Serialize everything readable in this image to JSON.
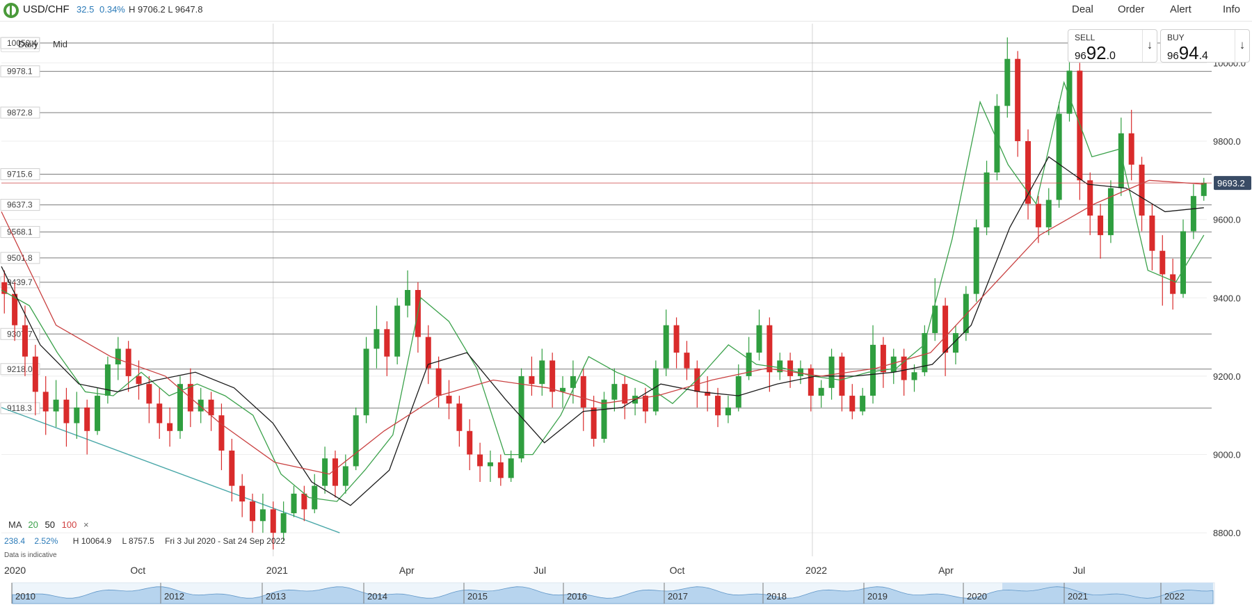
{
  "header": {
    "symbol": "USD/CHF",
    "change": "32.5",
    "change_pct": "0.34%",
    "high_low": "H 9706.2  L 9647.8",
    "menu": [
      "Deal",
      "Order",
      "Alert",
      "Info"
    ]
  },
  "sell": {
    "label": "SELL",
    "p1": "96",
    "p2": "92",
    "p3": ".0"
  },
  "buy": {
    "label": "BUY",
    "p1": "96",
    "p2": "94",
    "p3": ".4"
  },
  "toolbar": {
    "timeframe": "Daily",
    "price_type": "Mid"
  },
  "ma_legend": {
    "label": "MA",
    "ma20": "20",
    "ma50": "50",
    "ma100": "100",
    "close": "×"
  },
  "stats": {
    "change": "238.4",
    "pct": "2.52%",
    "high": "H 10064.9",
    "low": "L 8757.5",
    "range": "Fri 3 Jul 2020 - Sat 24 Sep 2022"
  },
  "disclaimer": "Data is indicative",
  "colors": {
    "up": "#2f9e3f",
    "down": "#d92b2b",
    "ma20": "#3aa14a",
    "ma50": "#1a1a1a",
    "ma100": "#c94040",
    "trend": "#49a7a8",
    "accent": "#2a7ab8",
    "current_tag": "#394b65"
  },
  "chart_data": {
    "type": "candlestick",
    "series": [
      {
        "name": "MA 20",
        "values": [
          9420,
          9380,
          9260,
          9160,
          9150,
          9210,
          9150,
          9180,
          9150,
          9100,
          8950,
          8890,
          8880,
          8960,
          9050,
          9400,
          9340,
          9220,
          9000,
          9000,
          9100,
          9250,
          9210,
          9180,
          9130,
          9200,
          9280,
          9230,
          9220,
          9200,
          9190,
          9210,
          9220,
          9280,
          9550,
          9900,
          9740,
          9640,
          9950,
          9760,
          9780,
          9470,
          9440,
          9560
        ]
      },
      {
        "name": "MA 50",
        "values": [
          9480,
          9280,
          9180,
          9160,
          9190,
          9210,
          9170,
          9080,
          8930,
          8870,
          8960,
          9230,
          9260,
          9140,
          9030,
          9110,
          9120,
          9180,
          9160,
          9150,
          9180,
          9200,
          9200,
          9210,
          9230,
          9330,
          9580,
          9760,
          9690,
          9680,
          9620,
          9630
        ]
      },
      {
        "name": "MA 100",
        "values": [
          9620,
          9330,
          9250,
          9200,
          9080,
          8980,
          8950,
          9060,
          9150,
          9190,
          9170,
          9130,
          9150,
          9190,
          9220,
          9200,
          9220,
          9260,
          9410,
          9560,
          9640,
          9700,
          9690
        ]
      },
      {
        "name": "Trendline",
        "values": [
          9120,
          8800
        ]
      }
    ],
    "candles": [
      {
        "d": "2020-07-03",
        "o": 9440,
        "h": 9470,
        "c": 9410,
        "l": 9360
      },
      {
        "d": "2020-07-10",
        "o": 9410,
        "h": 9440,
        "c": 9330,
        "l": 9290
      },
      {
        "d": "2020-07-17",
        "o": 9330,
        "h": 9380,
        "c": 9250,
        "l": 9200
      },
      {
        "d": "2020-07-24",
        "o": 9250,
        "h": 9280,
        "c": 9160,
        "l": 9100
      },
      {
        "d": "2020-07-31",
        "o": 9160,
        "h": 9200,
        "c": 9110,
        "l": 9050
      },
      {
        "d": "2020-08-07",
        "o": 9110,
        "h": 9190,
        "c": 9140,
        "l": 9070
      },
      {
        "d": "2020-08-14",
        "o": 9140,
        "h": 9170,
        "c": 9080,
        "l": 9020
      },
      {
        "d": "2020-08-21",
        "o": 9080,
        "h": 9160,
        "c": 9120,
        "l": 9040
      },
      {
        "d": "2020-08-28",
        "o": 9120,
        "h": 9140,
        "c": 9060,
        "l": 9000
      },
      {
        "d": "2020-09-04",
        "o": 9060,
        "h": 9170,
        "c": 9150,
        "l": 9050
      },
      {
        "d": "2020-09-11",
        "o": 9150,
        "h": 9250,
        "c": 9230,
        "l": 9130
      },
      {
        "d": "2020-09-18",
        "o": 9230,
        "h": 9300,
        "c": 9270,
        "l": 9190
      },
      {
        "d": "2020-09-25",
        "o": 9270,
        "h": 9290,
        "c": 9200,
        "l": 9160
      },
      {
        "d": "2020-10-02",
        "o": 9200,
        "h": 9240,
        "c": 9180,
        "l": 9140
      },
      {
        "d": "2020-10-09",
        "o": 9180,
        "h": 9200,
        "c": 9130,
        "l": 9080
      },
      {
        "d": "2020-10-16",
        "o": 9130,
        "h": 9170,
        "c": 9080,
        "l": 9040
      },
      {
        "d": "2020-10-23",
        "o": 9080,
        "h": 9120,
        "c": 9060,
        "l": 9020
      },
      {
        "d": "2020-10-30",
        "o": 9060,
        "h": 9200,
        "c": 9180,
        "l": 9040
      },
      {
        "d": "2020-11-06",
        "o": 9180,
        "h": 9220,
        "c": 9110,
        "l": 9070
      },
      {
        "d": "2020-11-13",
        "o": 9110,
        "h": 9170,
        "c": 9140,
        "l": 9080
      },
      {
        "d": "2020-11-20",
        "o": 9140,
        "h": 9160,
        "c": 9100,
        "l": 9060
      },
      {
        "d": "2020-11-27",
        "o": 9100,
        "h": 9130,
        "c": 9010,
        "l": 8960
      },
      {
        "d": "2020-12-04",
        "o": 9010,
        "h": 9040,
        "c": 8920,
        "l": 8880
      },
      {
        "d": "2020-12-11",
        "o": 8920,
        "h": 8950,
        "c": 8880,
        "l": 8840
      },
      {
        "d": "2020-12-18",
        "o": 8880,
        "h": 8900,
        "c": 8830,
        "l": 8800
      },
      {
        "d": "2020-12-25",
        "o": 8830,
        "h": 8900,
        "c": 8860,
        "l": 8800
      },
      {
        "d": "2021-01-01",
        "o": 8860,
        "h": 8880,
        "c": 8800,
        "l": 8757.5
      },
      {
        "d": "2021-01-08",
        "o": 8800,
        "h": 8880,
        "c": 8850,
        "l": 8780
      },
      {
        "d": "2021-01-15",
        "o": 8850,
        "h": 8920,
        "c": 8900,
        "l": 8840
      },
      {
        "d": "2021-01-22",
        "o": 8900,
        "h": 8920,
        "c": 8860,
        "l": 8830
      },
      {
        "d": "2021-01-29",
        "o": 8860,
        "h": 8950,
        "c": 8920,
        "l": 8850
      },
      {
        "d": "2021-02-05",
        "o": 8920,
        "h": 9020,
        "c": 8990,
        "l": 8900
      },
      {
        "d": "2021-02-12",
        "o": 8990,
        "h": 9010,
        "c": 8920,
        "l": 8890
      },
      {
        "d": "2021-02-19",
        "o": 8920,
        "h": 9000,
        "c": 8970,
        "l": 8900
      },
      {
        "d": "2021-02-26",
        "o": 8970,
        "h": 9120,
        "c": 9100,
        "l": 8960
      },
      {
        "d": "2021-03-05",
        "o": 9100,
        "h": 9300,
        "c": 9270,
        "l": 9080
      },
      {
        "d": "2021-03-12",
        "o": 9270,
        "h": 9380,
        "c": 9320,
        "l": 9220
      },
      {
        "d": "2021-03-19",
        "o": 9320,
        "h": 9340,
        "c": 9250,
        "l": 9200
      },
      {
        "d": "2021-03-26",
        "o": 9250,
        "h": 9400,
        "c": 9380,
        "l": 9230
      },
      {
        "d": "2021-04-02",
        "o": 9380,
        "h": 9470,
        "c": 9420,
        "l": 9350
      },
      {
        "d": "2021-04-09",
        "o": 9420,
        "h": 9440,
        "c": 9300,
        "l": 9260
      },
      {
        "d": "2021-04-16",
        "o": 9300,
        "h": 9330,
        "c": 9220,
        "l": 9180
      },
      {
        "d": "2021-04-23",
        "o": 9220,
        "h": 9250,
        "c": 9150,
        "l": 9120
      },
      {
        "d": "2021-04-30",
        "o": 9150,
        "h": 9190,
        "c": 9130,
        "l": 9090
      },
      {
        "d": "2021-05-07",
        "o": 9130,
        "h": 9150,
        "c": 9060,
        "l": 9020
      },
      {
        "d": "2021-05-14",
        "o": 9060,
        "h": 9090,
        "c": 9000,
        "l": 8960
      },
      {
        "d": "2021-05-21",
        "o": 9000,
        "h": 9030,
        "c": 8970,
        "l": 8930
      },
      {
        "d": "2021-05-28",
        "o": 8970,
        "h": 9010,
        "c": 8980,
        "l": 8930
      },
      {
        "d": "2021-06-04",
        "o": 8980,
        "h": 9000,
        "c": 8940,
        "l": 8920
      },
      {
        "d": "2021-06-11",
        "o": 8940,
        "h": 9010,
        "c": 8990,
        "l": 8930
      },
      {
        "d": "2021-06-18",
        "o": 8990,
        "h": 9220,
        "c": 9200,
        "l": 8980
      },
      {
        "d": "2021-06-25",
        "o": 9200,
        "h": 9250,
        "c": 9180,
        "l": 9150
      },
      {
        "d": "2021-07-02",
        "o": 9180,
        "h": 9270,
        "c": 9240,
        "l": 9150
      },
      {
        "d": "2021-07-09",
        "o": 9240,
        "h": 9260,
        "c": 9160,
        "l": 9120
      },
      {
        "d": "2021-07-16",
        "o": 9160,
        "h": 9200,
        "c": 9170,
        "l": 9120
      },
      {
        "d": "2021-07-23",
        "o": 9170,
        "h": 9240,
        "c": 9200,
        "l": 9130
      },
      {
        "d": "2021-07-30",
        "o": 9200,
        "h": 9220,
        "c": 9120,
        "l": 9060
      },
      {
        "d": "2021-08-06",
        "o": 9120,
        "h": 9150,
        "c": 9040,
        "l": 9020
      },
      {
        "d": "2021-08-13",
        "o": 9040,
        "h": 9160,
        "c": 9140,
        "l": 9030
      },
      {
        "d": "2021-08-20",
        "o": 9140,
        "h": 9220,
        "c": 9180,
        "l": 9110
      },
      {
        "d": "2021-08-27",
        "o": 9180,
        "h": 9200,
        "c": 9130,
        "l": 9090
      },
      {
        "d": "2021-09-03",
        "o": 9130,
        "h": 9170,
        "c": 9150,
        "l": 9100
      },
      {
        "d": "2021-09-10",
        "o": 9150,
        "h": 9170,
        "c": 9110,
        "l": 9080
      },
      {
        "d": "2021-09-17",
        "o": 9110,
        "h": 9240,
        "c": 9220,
        "l": 9100
      },
      {
        "d": "2021-09-24",
        "o": 9220,
        "h": 9370,
        "c": 9330,
        "l": 9200
      },
      {
        "d": "2021-10-01",
        "o": 9330,
        "h": 9350,
        "c": 9260,
        "l": 9220
      },
      {
        "d": "2021-10-08",
        "o": 9260,
        "h": 9290,
        "c": 9220,
        "l": 9190
      },
      {
        "d": "2021-10-15",
        "o": 9220,
        "h": 9240,
        "c": 9160,
        "l": 9120
      },
      {
        "d": "2021-10-22",
        "o": 9160,
        "h": 9200,
        "c": 9150,
        "l": 9110
      },
      {
        "d": "2021-10-29",
        "o": 9150,
        "h": 9170,
        "c": 9100,
        "l": 9070
      },
      {
        "d": "2021-11-05",
        "o": 9100,
        "h": 9150,
        "c": 9120,
        "l": 9080
      },
      {
        "d": "2021-11-12",
        "o": 9120,
        "h": 9230,
        "c": 9200,
        "l": 9110
      },
      {
        "d": "2021-11-19",
        "o": 9200,
        "h": 9300,
        "c": 9260,
        "l": 9190
      },
      {
        "d": "2021-11-26",
        "o": 9260,
        "h": 9370,
        "c": 9330,
        "l": 9240
      },
      {
        "d": "2021-12-03",
        "o": 9330,
        "h": 9350,
        "c": 9210,
        "l": 9160
      },
      {
        "d": "2021-12-10",
        "o": 9210,
        "h": 9260,
        "c": 9240,
        "l": 9190
      },
      {
        "d": "2021-12-17",
        "o": 9240,
        "h": 9260,
        "c": 9200,
        "l": 9170
      },
      {
        "d": "2021-12-24",
        "o": 9200,
        "h": 9240,
        "c": 9220,
        "l": 9180
      },
      {
        "d": "2021-12-31",
        "o": 9220,
        "h": 9230,
        "c": 9150,
        "l": 9110
      },
      {
        "d": "2022-01-07",
        "o": 9150,
        "h": 9190,
        "c": 9170,
        "l": 9120
      },
      {
        "d": "2022-01-14",
        "o": 9170,
        "h": 9270,
        "c": 9250,
        "l": 9140
      },
      {
        "d": "2022-01-21",
        "o": 9250,
        "h": 9260,
        "c": 9150,
        "l": 9110
      },
      {
        "d": "2022-01-28",
        "o": 9150,
        "h": 9180,
        "c": 9110,
        "l": 9090
      },
      {
        "d": "2022-02-04",
        "o": 9110,
        "h": 9170,
        "c": 9150,
        "l": 9100
      },
      {
        "d": "2022-02-11",
        "o": 9150,
        "h": 9330,
        "c": 9280,
        "l": 9130
      },
      {
        "d": "2022-02-18",
        "o": 9280,
        "h": 9300,
        "c": 9210,
        "l": 9170
      },
      {
        "d": "2022-02-25",
        "o": 9210,
        "h": 9270,
        "c": 9250,
        "l": 9180
      },
      {
        "d": "2022-03-04",
        "o": 9250,
        "h": 9270,
        "c": 9190,
        "l": 9150
      },
      {
        "d": "2022-03-11",
        "o": 9190,
        "h": 9230,
        "c": 9210,
        "l": 9160
      },
      {
        "d": "2022-03-18",
        "o": 9210,
        "h": 9330,
        "c": 9310,
        "l": 9200
      },
      {
        "d": "2022-03-25",
        "o": 9310,
        "h": 9450,
        "c": 9380,
        "l": 9290
      },
      {
        "d": "2022-04-01",
        "o": 9380,
        "h": 9400,
        "c": 9260,
        "l": 9200
      },
      {
        "d": "2022-04-08",
        "o": 9260,
        "h": 9330,
        "c": 9310,
        "l": 9230
      },
      {
        "d": "2022-04-15",
        "o": 9310,
        "h": 9430,
        "c": 9410,
        "l": 9290
      },
      {
        "d": "2022-04-22",
        "o": 9410,
        "h": 9600,
        "c": 9580,
        "l": 9390
      },
      {
        "d": "2022-04-29",
        "o": 9580,
        "h": 9750,
        "c": 9720,
        "l": 9560
      },
      {
        "d": "2022-05-06",
        "o": 9720,
        "h": 9920,
        "c": 9890,
        "l": 9700
      },
      {
        "d": "2022-05-13",
        "o": 9890,
        "h": 10064.9,
        "c": 10010,
        "l": 9860
      },
      {
        "d": "2022-05-20",
        "o": 10010,
        "h": 10030,
        "c": 9800,
        "l": 9760
      },
      {
        "d": "2022-05-27",
        "o": 9800,
        "h": 9830,
        "c": 9640,
        "l": 9600
      },
      {
        "d": "2022-06-03",
        "o": 9640,
        "h": 9660,
        "c": 9580,
        "l": 9540
      },
      {
        "d": "2022-06-10",
        "o": 9580,
        "h": 9680,
        "c": 9650,
        "l": 9560
      },
      {
        "d": "2022-06-17",
        "o": 9650,
        "h": 9900,
        "c": 9870,
        "l": 9630
      },
      {
        "d": "2022-06-24",
        "o": 9870,
        "h": 10040,
        "c": 9980,
        "l": 9850
      },
      {
        "d": "2022-07-01",
        "o": 9980,
        "h": 10000,
        "c": 9700,
        "l": 9650
      },
      {
        "d": "2022-07-08",
        "o": 9700,
        "h": 9720,
        "c": 9610,
        "l": 9560
      },
      {
        "d": "2022-07-15",
        "o": 9610,
        "h": 9640,
        "c": 9560,
        "l": 9500
      },
      {
        "d": "2022-07-22",
        "o": 9560,
        "h": 9700,
        "c": 9680,
        "l": 9540
      },
      {
        "d": "2022-07-29",
        "o": 9680,
        "h": 9860,
        "c": 9820,
        "l": 9660
      },
      {
        "d": "2022-08-05",
        "o": 9820,
        "h": 9880,
        "c": 9740,
        "l": 9700
      },
      {
        "d": "2022-08-12",
        "o": 9740,
        "h": 9760,
        "c": 9610,
        "l": 9570
      },
      {
        "d": "2022-08-19",
        "o": 9610,
        "h": 9640,
        "c": 9520,
        "l": 9470
      },
      {
        "d": "2022-08-26",
        "o": 9520,
        "h": 9560,
        "c": 9460,
        "l": 9380
      },
      {
        "d": "2022-09-02",
        "o": 9460,
        "h": 9500,
        "c": 9410,
        "l": 9370
      },
      {
        "d": "2022-09-09",
        "o": 9410,
        "h": 9600,
        "c": 9570,
        "l": 9400
      },
      {
        "d": "2022-09-16",
        "o": 9570,
        "h": 9690,
        "c": 9660,
        "l": 9550
      },
      {
        "d": "2022-09-23",
        "o": 9660,
        "h": 9706.2,
        "c": 9693.2,
        "l": 9647.8
      }
    ],
    "date_range": [
      "2020-07-03",
      "2022-09-24"
    ],
    "x_tick_labels": [
      "2020",
      "Oct",
      "2021",
      "Apr",
      "Jul",
      "Oct",
      "2022",
      "Apr",
      "Jul"
    ],
    "y_ticks": [
      8800,
      9000,
      9200,
      9400,
      9600,
      9800,
      10000
    ],
    "y_tick_labels": [
      "8800.0",
      "9000.0",
      "9200.0",
      "9400.0",
      "9600.0",
      "9800.0",
      "10000.0"
    ],
    "ylim": [
      8740,
      10100
    ],
    "horizontal_levels": [
      10050.4,
      9978.1,
      9872.8,
      9715.6,
      9637.3,
      9568.1,
      9501.8,
      9439.7,
      9307.7,
      9218.0,
      9118.3
    ],
    "level_labels": [
      "10050.4",
      "9978.1",
      "9872.8",
      "9715.6",
      "9637.3",
      "9568.1",
      "9501.8",
      "9439.7",
      "9307.7",
      "9218.0",
      "9118.3"
    ],
    "current_price": 9693.2,
    "current_price_label": "9693.2",
    "navigator_years": [
      "2010",
      "2012",
      "2013",
      "2014",
      "2015",
      "2016",
      "2017",
      "2018",
      "2019",
      "2020",
      "2021",
      "2022"
    ],
    "grid": true
  }
}
